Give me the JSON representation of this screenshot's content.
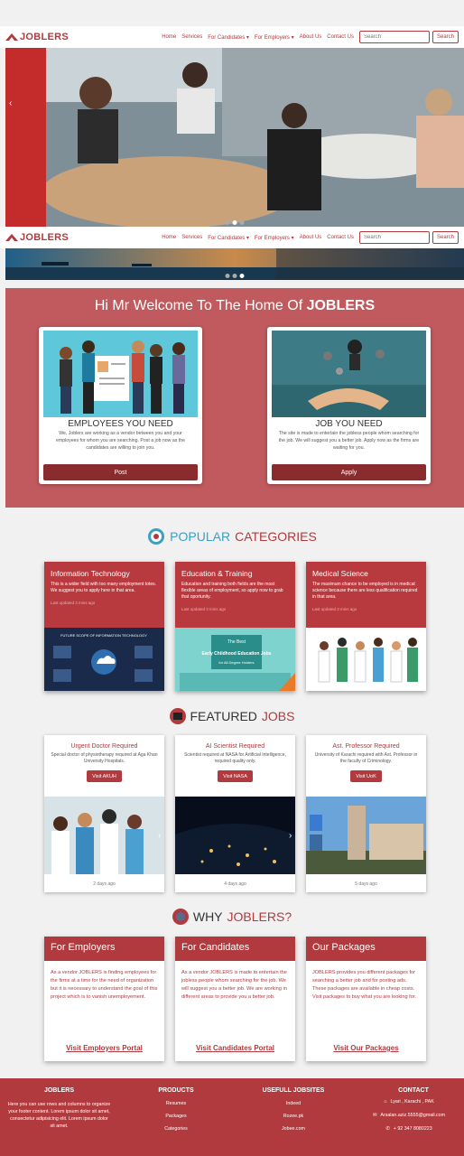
{
  "nav": {
    "brand": "JOBLERS",
    "links": [
      "Home",
      "Services",
      "For Candidates ▾",
      "For Employers ▾",
      "About Us",
      "Contact Us"
    ],
    "search_placeholder": "Search",
    "search_button": "Search"
  },
  "welcome": {
    "title_prefix": "Hi Mr Welcome To The Home Of ",
    "title_brand": "JOBLERS",
    "employees": {
      "title": "EMPLOYEES YOU NEED",
      "text": "We, Joblers are working as a vendor between you and your employees for whom you are searching. Post a job now as the candidates are willing to join you.",
      "button": "Post"
    },
    "job": {
      "title": "JOB YOU NEED",
      "text": "The site is made to entertain the jobless people whom searching for the job. We will suggest you a better job. Apply now as the firms are waiting for you.",
      "button": "Apply"
    }
  },
  "popular": {
    "word1": "POPULAR",
    "word2": "CATEGORIES",
    "cards": [
      {
        "title": "Information Technology",
        "text": "This is a wider field with too many employment totes. We suggest you to apply here in that area.",
        "updated": "Last updated 3 mins ago",
        "banner": "FUTURE SCOPE OF INFORMATION TECHNOLOGY"
      },
      {
        "title": "Education & Training",
        "text": "Education and training both fields are the most flexible areas of employment, so apply now to grab that oportunity.",
        "updated": "Last updated 3 mins ago",
        "banner_line1": "The Best",
        "banner_line2": "Early Childhood Education Jobs",
        "banner_line3": "for All Degree Holders"
      },
      {
        "title": "Medical Science",
        "text": "The maximum chance to be employed is in medical science because there are less qualification required in that area.",
        "updated": "Last updated 3 mins ago"
      }
    ]
  },
  "featured": {
    "word1": "FEATURED",
    "word2": "JOBS",
    "cards": [
      {
        "title": "Urgent Doctor Required",
        "text": "Special doctor of physiotherapy required at Aga Khan University Hospitals.",
        "button": "Visit AKUH",
        "ago": "2 days ago"
      },
      {
        "title": "AI Scientist Required",
        "text": "Scientist required at NASA for Artificial Intelligence, required quality only.",
        "button": "Visit NASA",
        "ago": "4 days ago"
      },
      {
        "title": "Ast. Professor Required",
        "text": "University of Karachi required with Ast. Professor in the faculty of Criminology.",
        "button": "Visit UoK",
        "ago": "5 days ago"
      }
    ]
  },
  "why": {
    "word1": "WHY",
    "word2": "JOBLERS?",
    "cards": [
      {
        "title": "For Employers",
        "text": "As a vendor JOBLERS is finding employees for the firms at a time for the need of organization but it is necessary to understand the goal of this project which is to vanish unemployement.",
        "link": "Visit Employers Portal"
      },
      {
        "title": "For Candidates",
        "text": "As a vendor JOBLERS is made to entertain the jobless people whom searching for the job. We will suggest you a better job. We are working in different areas to provide you a better job.",
        "link": "Visit Candidates Portal"
      },
      {
        "title": "Our Packages",
        "text": "JOBLERS provides you different packages for searching a better job and for posting ads. These packages are available in cheap costs. Visit packages to buy what you are looking for.",
        "link": "Visit Our Packages"
      }
    ]
  },
  "footer": {
    "about": {
      "title": "JOBLERS",
      "text": "Here you can use rows and columns to organize your footer content. Lorem ipsum dolor sit amet, consectetur adipisicing elit. Lorem ipsum dolor sit amet."
    },
    "products": {
      "title": "PRODUCTS",
      "items": [
        "Resumes",
        "Packages",
        "Categories"
      ]
    },
    "websites": {
      "title": "USEFULL JOBSITES",
      "items": [
        "Indeed",
        "Rozee.pk",
        "Jobee.com"
      ]
    },
    "contact": {
      "title": "CONTACT",
      "address": "Lyari , Karachi , PAK",
      "email": "Arsalan.aziz.5555@gmail.com",
      "phone": "+ 92 347 8080223"
    }
  },
  "colors": {
    "brand": "#b03a3e",
    "welcome_bg": "#c05a5e",
    "button_dark": "#8a2b2e"
  }
}
